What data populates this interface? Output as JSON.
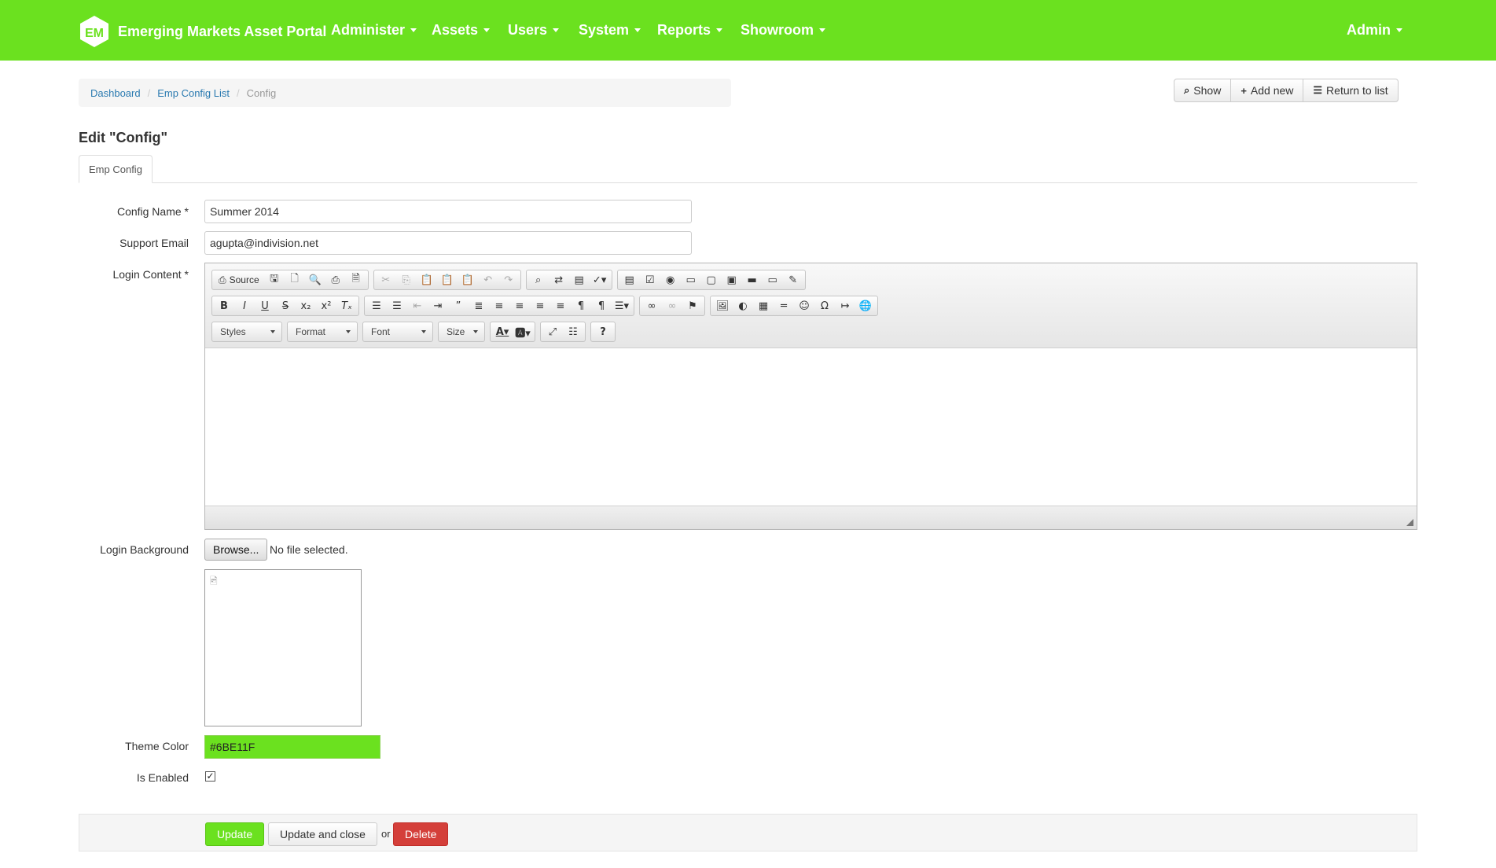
{
  "navbar": {
    "brand": "Emerging Markets Asset Portal",
    "logo_text": "EM",
    "items": [
      "Administer",
      "Assets",
      "Users",
      "System",
      "Reports",
      "Showroom"
    ],
    "user": "Admin",
    "color": "#6BE11F"
  },
  "breadcrumb": {
    "items": [
      "Dashboard",
      "Emp Config List"
    ],
    "active": "Config"
  },
  "actions": {
    "show": "Show",
    "add_new": "Add new",
    "return_to_list": "Return to list"
  },
  "page": {
    "title": "Edit \"Config\"",
    "tab": "Emp Config"
  },
  "form": {
    "config_name_label": "Config Name *",
    "config_name_value": "Summer 2014",
    "support_email_label": "Support Email",
    "support_email_value": "agupta@indivision.net",
    "login_content_label": "Login Content *",
    "login_background_label": "Login Background",
    "browse_label": "Browse...",
    "no_file": "No file selected.",
    "theme_color_label": "Theme Color",
    "theme_color_value": "#6BE11F",
    "is_enabled_label": "Is Enabled",
    "is_enabled": true
  },
  "editor": {
    "source_label": "Source",
    "styles_label": "Styles",
    "format_label": "Format",
    "font_label": "Font",
    "size_label": "Size"
  },
  "footer": {
    "update": "Update",
    "update_close": "Update and close",
    "or": "or",
    "delete": "Delete",
    "update_color": "#6BE11F",
    "delete_color": "#D43F3A"
  }
}
